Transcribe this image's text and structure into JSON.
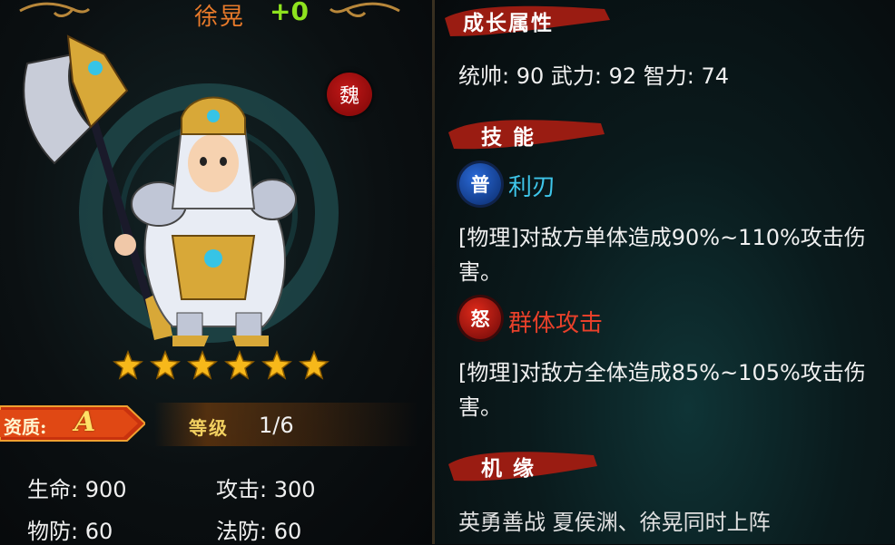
{
  "hero": {
    "name": "徐晃",
    "plus": "+0",
    "faction": "魏",
    "stars": 6
  },
  "quality": {
    "label": "资质:",
    "grade": "A"
  },
  "level": {
    "label": "等级",
    "value": "1/6"
  },
  "stats": {
    "hp": "生命: 900",
    "attack": "攻击: 300",
    "pdef": "物防: 60",
    "mdef": "法防: 60"
  },
  "growth": {
    "title": "成长属性",
    "line": "统帅: 90   武力: 92   智力: 74"
  },
  "skills": {
    "title": "技 能",
    "normal": {
      "badge": "普",
      "name": "利刃",
      "desc": "[物理]对敌方单体造成90%~110%攻击伤害。",
      "color": "#3ec6ea"
    },
    "rage": {
      "badge": "怒",
      "name": "群体攻击",
      "desc": "[物理]对敌方全体造成85%~105%攻击伤害。",
      "color": "#e8402a"
    }
  },
  "fate": {
    "title": "机 缘",
    "line": "英勇善战  夏侯渊、徐晃同时上阵"
  },
  "colors": {
    "name": "#e87a2a",
    "plus": "#8ee31e",
    "gold": "#f2d060",
    "brush": "#a01e14"
  }
}
